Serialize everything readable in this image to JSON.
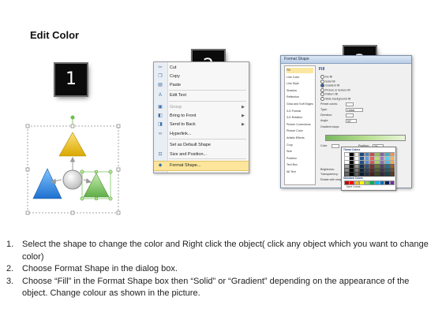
{
  "title": "Edit Color",
  "steps": [
    "1",
    "2",
    "3"
  ],
  "context_menu": {
    "items": [
      {
        "label": "Cut",
        "icon": "scissors-icon",
        "glyph": "✂",
        "state": "normal",
        "submenu": false
      },
      {
        "label": "Copy",
        "icon": "copy-icon",
        "glyph": "❐",
        "state": "normal",
        "submenu": false
      },
      {
        "label": "Paste",
        "icon": "paste-icon",
        "glyph": "▤",
        "state": "normal",
        "submenu": false
      },
      {
        "label": "Edit Text",
        "icon": "edit-text-icon",
        "glyph": "A",
        "state": "normal",
        "submenu": false
      },
      {
        "label": "Group",
        "icon": "group-icon",
        "glyph": "▣",
        "state": "disabled",
        "submenu": true
      },
      {
        "label": "Bring to Front",
        "icon": "bring-to-front-icon",
        "glyph": "◧",
        "state": "normal",
        "submenu": true
      },
      {
        "label": "Send to Back",
        "icon": "send-to-back-icon",
        "glyph": "◨",
        "state": "normal",
        "submenu": true
      },
      {
        "label": "Hyperlink...",
        "icon": "hyperlink-icon",
        "glyph": "∞",
        "state": "normal",
        "submenu": false
      },
      {
        "label": "Set as Default Shape",
        "icon": "",
        "glyph": "",
        "state": "normal",
        "submenu": false
      },
      {
        "label": "Size and Position...",
        "icon": "size-position-icon",
        "glyph": "⊡",
        "state": "normal",
        "submenu": false
      },
      {
        "label": "Format Shape...",
        "icon": "format-shape-icon",
        "glyph": "◆",
        "state": "highlight",
        "submenu": false
      }
    ]
  },
  "format_dialog": {
    "title": "Format Shape",
    "categories": [
      "Fill",
      "Line Color",
      "Line Style",
      "Shadow",
      "Reflection",
      "Glow and Soft Edges",
      "3-D Format",
      "3-D Rotation",
      "Picture Corrections",
      "Picture Color",
      "Artistic Effects",
      "Crop",
      "Size",
      "Position",
      "Text Box",
      "Alt Text"
    ],
    "fill_heading": "Fill",
    "fill_options": [
      "No fill",
      "Solid fill",
      "Gradient fill",
      "Picture or texture fill",
      "Pattern fill",
      "Slide background fill"
    ],
    "fields": [
      "Preset colors:",
      "Type:",
      "Direction:",
      "Angle:",
      "Gradient stops",
      "Color",
      "Position:",
      "Brightness:",
      "Transparency:",
      "Rotate with shape"
    ],
    "type_value": "Linear",
    "angle_value": "90°",
    "position_value": "0%",
    "palette": {
      "theme_heading": "Theme Colors",
      "standard_heading": "Standard Colors",
      "more_colors": "More Colors..."
    }
  },
  "instructions": [
    {
      "num": "1.",
      "text": "Select the shape to change the color and Right click the object( click any object which you want to change color)"
    },
    {
      "num": "2.",
      "text": "Choose Format Shape in the dialog box."
    },
    {
      "num": "3.",
      "text": "Choose “Fill” in the Format Shape box then “Solid” or “Gradient” depending on the appearance of the object. Change colour as shown in the picture."
    }
  ]
}
